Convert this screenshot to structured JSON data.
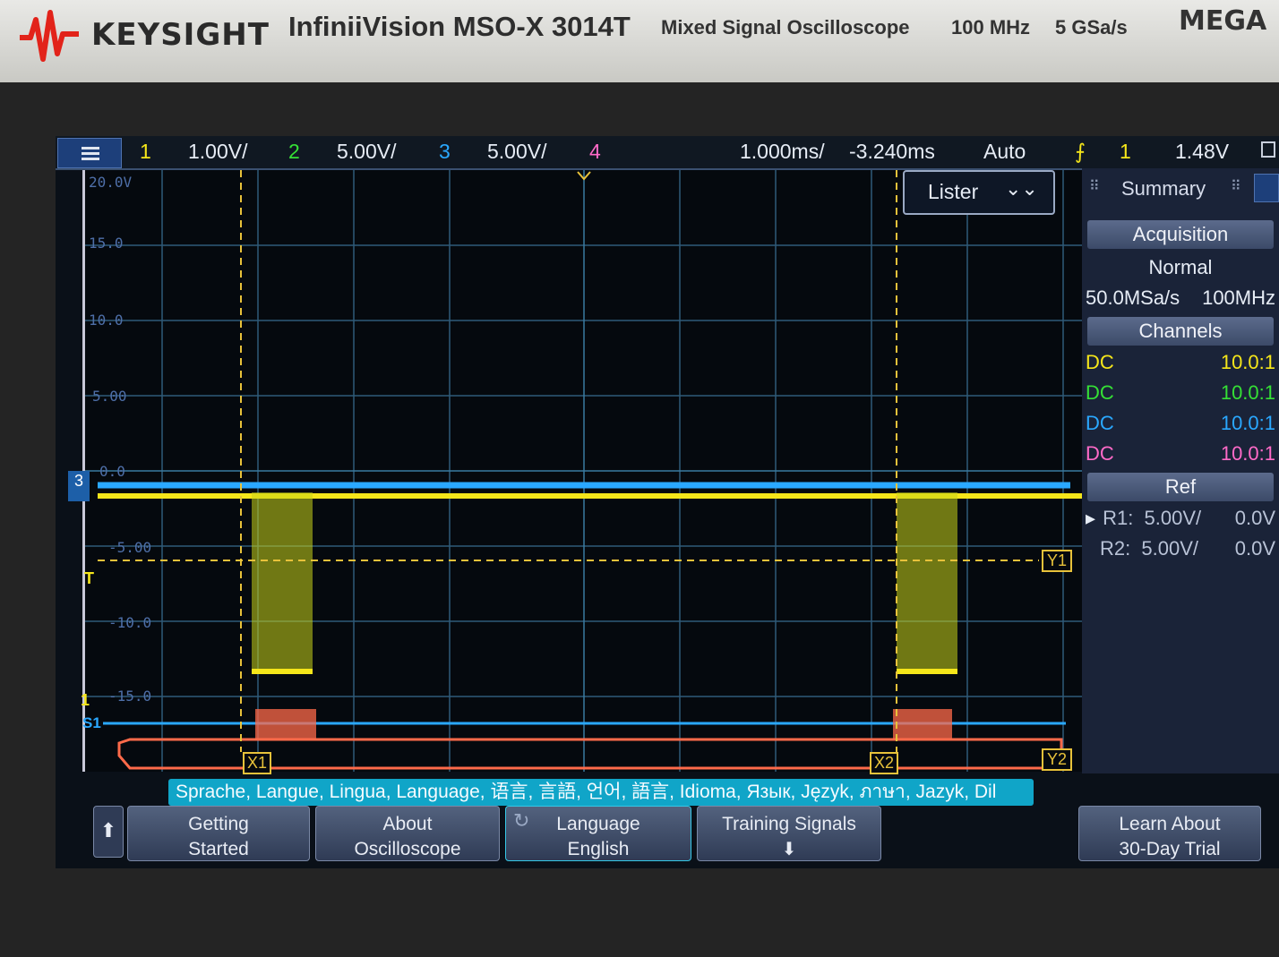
{
  "bezel": {
    "brand": "KEYSIGHT",
    "model": "InfiniiVision MSO-X 3014T",
    "description": "Mixed Signal Oscilloscope",
    "bandwidth": "100 MHz",
    "sample_rate": "5 GSa/s",
    "corner_logo": "MEGA"
  },
  "status": {
    "ch1_num": "1",
    "ch1_scale": "1.00V/",
    "ch2_num": "2",
    "ch2_scale": "5.00V/",
    "ch3_num": "3",
    "ch3_scale": "5.00V/",
    "ch4_num": "4",
    "timebase": "1.000ms/",
    "delay": "-3.240ms",
    "trigger_mode": "Auto",
    "trigger_source": "1",
    "trigger_level": "1.48V"
  },
  "plot": {
    "y_labels": [
      "20.0V",
      "15.0",
      "10.0",
      "5.00",
      "0.0",
      "-5.00",
      "-10.0",
      "-15.0"
    ],
    "cursor_x1": "X1",
    "cursor_x2": "X2",
    "cursor_y1": "Y1",
    "cursor_y2": "Y2",
    "ch3_marker": "3",
    "ch1_marker": "1",
    "trigger_marker": "T",
    "serial_marker": "S1"
  },
  "lister": {
    "label": "Lister"
  },
  "sidebar": {
    "title": "Summary",
    "acquisition_title": "Acquisition",
    "acquisition_mode": "Normal",
    "acq_rate": "50.0MSa/s",
    "acq_bw": "100MHz",
    "channels_title": "Channels",
    "channels": [
      {
        "coupling": "DC",
        "probe": "10.0:1",
        "color": "#f5e61a"
      },
      {
        "coupling": "DC",
        "probe": "10.0:1",
        "color": "#35e035"
      },
      {
        "coupling": "DC",
        "probe": "10.0:1",
        "color": "#2aa8ff"
      },
      {
        "coupling": "DC",
        "probe": "10.0:1",
        "color": "#ff6ac8"
      }
    ],
    "ref_title": "Ref",
    "refs": [
      {
        "name": "R1:",
        "scale": "5.00V/",
        "offset": "0.0V"
      },
      {
        "name": "R2:",
        "scale": "5.00V/",
        "offset": "0.0V"
      }
    ]
  },
  "language_bar": "Sprache, Langue, Lingua, Language, 语言, 言語, 언어, 語言, Idioma, Язык, Język, ภาษา, Jazyk, Dil",
  "softkeys": {
    "getting_started_1": "Getting",
    "getting_started_2": "Started",
    "about_1": "About",
    "about_2": "Oscilloscope",
    "language_1": "Language",
    "language_2": "English",
    "training": "Training Signals",
    "learn_1": "Learn About",
    "learn_2": "30-Day Trial"
  },
  "colors": {
    "ch1": "#f5e61a",
    "ch2": "#35e035",
    "ch3": "#2aa8ff",
    "ch4": "#ff6ac8",
    "serial": "#ff6a4a",
    "cursor": "#e8c23a",
    "lang_bar": "#10a5c8"
  }
}
